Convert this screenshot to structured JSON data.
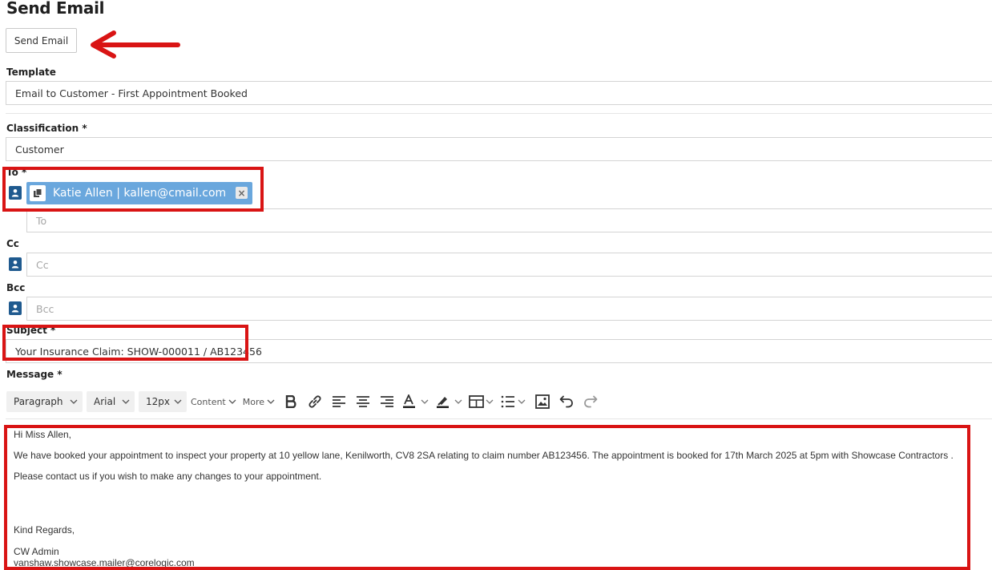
{
  "page": {
    "title": "Send Email"
  },
  "send_button": {
    "label": "Send Email"
  },
  "template": {
    "label": "Template",
    "value": "Email to Customer - First Appointment Booked"
  },
  "classification": {
    "label": "Classification *",
    "value": "Customer"
  },
  "to": {
    "label": "To *",
    "chip": "Katie Allen | kallen@cmail.com",
    "chip_remove": "×",
    "placeholder": "To"
  },
  "cc": {
    "label": "Cc",
    "placeholder": "Cc"
  },
  "bcc": {
    "label": "Bcc",
    "placeholder": "Bcc"
  },
  "subject": {
    "label": "Subject *",
    "value": "Your Insurance Claim: SHOW-000011 / AB123456"
  },
  "message": {
    "label": "Message *",
    "toolbar": {
      "block_format": "Paragraph",
      "font_family": "Arial",
      "font_size": "12px",
      "content_menu": "Content",
      "more_menu": "More",
      "icons": [
        "bold-icon",
        "link-icon",
        "align-left-icon",
        "align-center-icon",
        "align-right-icon",
        "text-color-icon",
        "highlight-icon",
        "table-icon",
        "list-icon",
        "image-icon",
        "undo-icon",
        "redo-icon"
      ]
    },
    "body": {
      "greeting": "Hi Miss Allen,",
      "paragraph1": "We have booked your appointment to inspect your property at 10 yellow lane, Kenilworth, CV8 2SA relating to claim number AB123456. The appointment is booked for 17th March 2025 at 5pm with Showcase Contractors .",
      "paragraph2": "Please contact us if you wish to make any changes to your appointment.",
      "signoff": "Kind Regards,",
      "signature_name": "CW Admin",
      "signature_email": "vanshaw.showcase.mailer@corelogic.com"
    }
  },
  "colors": {
    "annotation_red": "#d91414",
    "chip_blue": "#6aa7dd",
    "contact_icon": "#1f5a8f"
  }
}
